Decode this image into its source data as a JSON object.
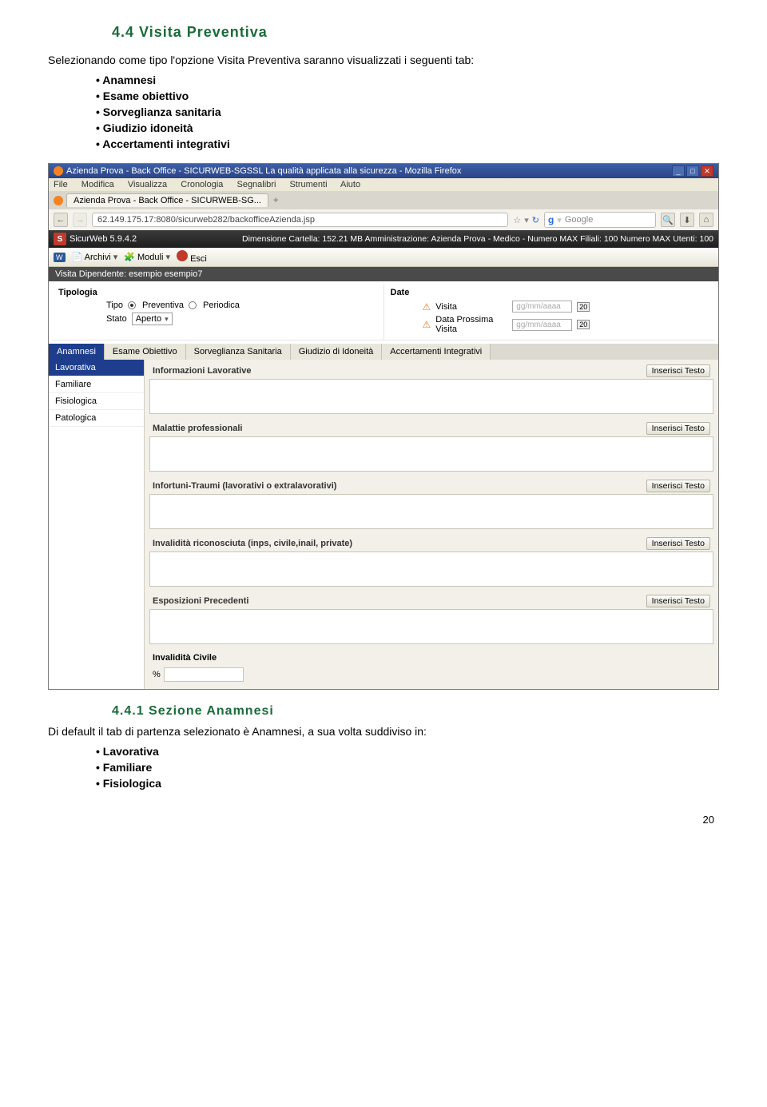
{
  "section_title": "4.4 Visita Preventiva",
  "intro": "Selezionando come tipo l'opzione Visita Preventiva saranno visualizzati i seguenti tab:",
  "bullets1": [
    "Anamnesi",
    "Esame obiettivo",
    "Sorveglianza sanitaria",
    "Giudizio idoneità",
    "Accertamenti integrativi"
  ],
  "subsection_title": "4.4.1 Sezione Anamnesi",
  "outro": "Di default il tab di partenza selezionato è Anamnesi, a sua volta suddiviso in:",
  "bullets2": [
    "Lavorativa",
    "Familiare",
    "Fisiologica"
  ],
  "page_num": "20",
  "ff": {
    "title": "Azienda Prova - Back Office - SICURWEB-SGSSL La qualità applicata alla sicurezza - Mozilla Firefox",
    "menu": [
      "File",
      "Modifica",
      "Visualizza",
      "Cronologia",
      "Segnalibri",
      "Strumenti",
      "Aiuto"
    ],
    "tab": "Azienda Prova - Back Office - SICURWEB-SG...",
    "url": "62.149.175.17:8080/sicurweb282/backofficeAzienda.jsp",
    "search_ph": "Google"
  },
  "app": {
    "name": "SicurWeb 5.9.4.2",
    "status": "Dimensione Cartella: 152.21 MB Amministrazione: Azienda Prova - Medico - Numero MAX Filiali: 100 Numero MAX Utenti: 100",
    "tb_archivi": "Archivi",
    "tb_moduli": "Moduli",
    "tb_esci": "Esci",
    "crumb": "Visita Dipendente: esempio esempio7"
  },
  "form": {
    "tipologia_title": "Tipologia",
    "tipo_label": "Tipo",
    "radio_prev": "Preventiva",
    "radio_per": "Periodica",
    "stato_label": "Stato",
    "stato_value": "Aperto",
    "date_title": "Date",
    "visita_label": "Visita",
    "prossima_label": "Data Prossima Visita",
    "date_ph": "gg/mm/aaaa",
    "cal": "20"
  },
  "tabs": [
    "Anamnesi",
    "Esame Obiettivo",
    "Sorveglianza Sanitaria",
    "Giudizio di Idoneità",
    "Accertamenti Integrativi"
  ],
  "subtabs": [
    "Lavorativa",
    "Familiare",
    "Fisiologica",
    "Patologica"
  ],
  "blocks": {
    "b1": "Informazioni Lavorative",
    "b2": "Malattie professionali",
    "b3": "Infortuni-Traumi (lavorativi o extralavorativi)",
    "b4": "Invalidità riconosciuta (inps, civile,inail, private)",
    "b5": "Esposizioni Precedenti",
    "inv": "Invalidità Civile",
    "pct": "%",
    "btn": "Inserisci Testo"
  }
}
